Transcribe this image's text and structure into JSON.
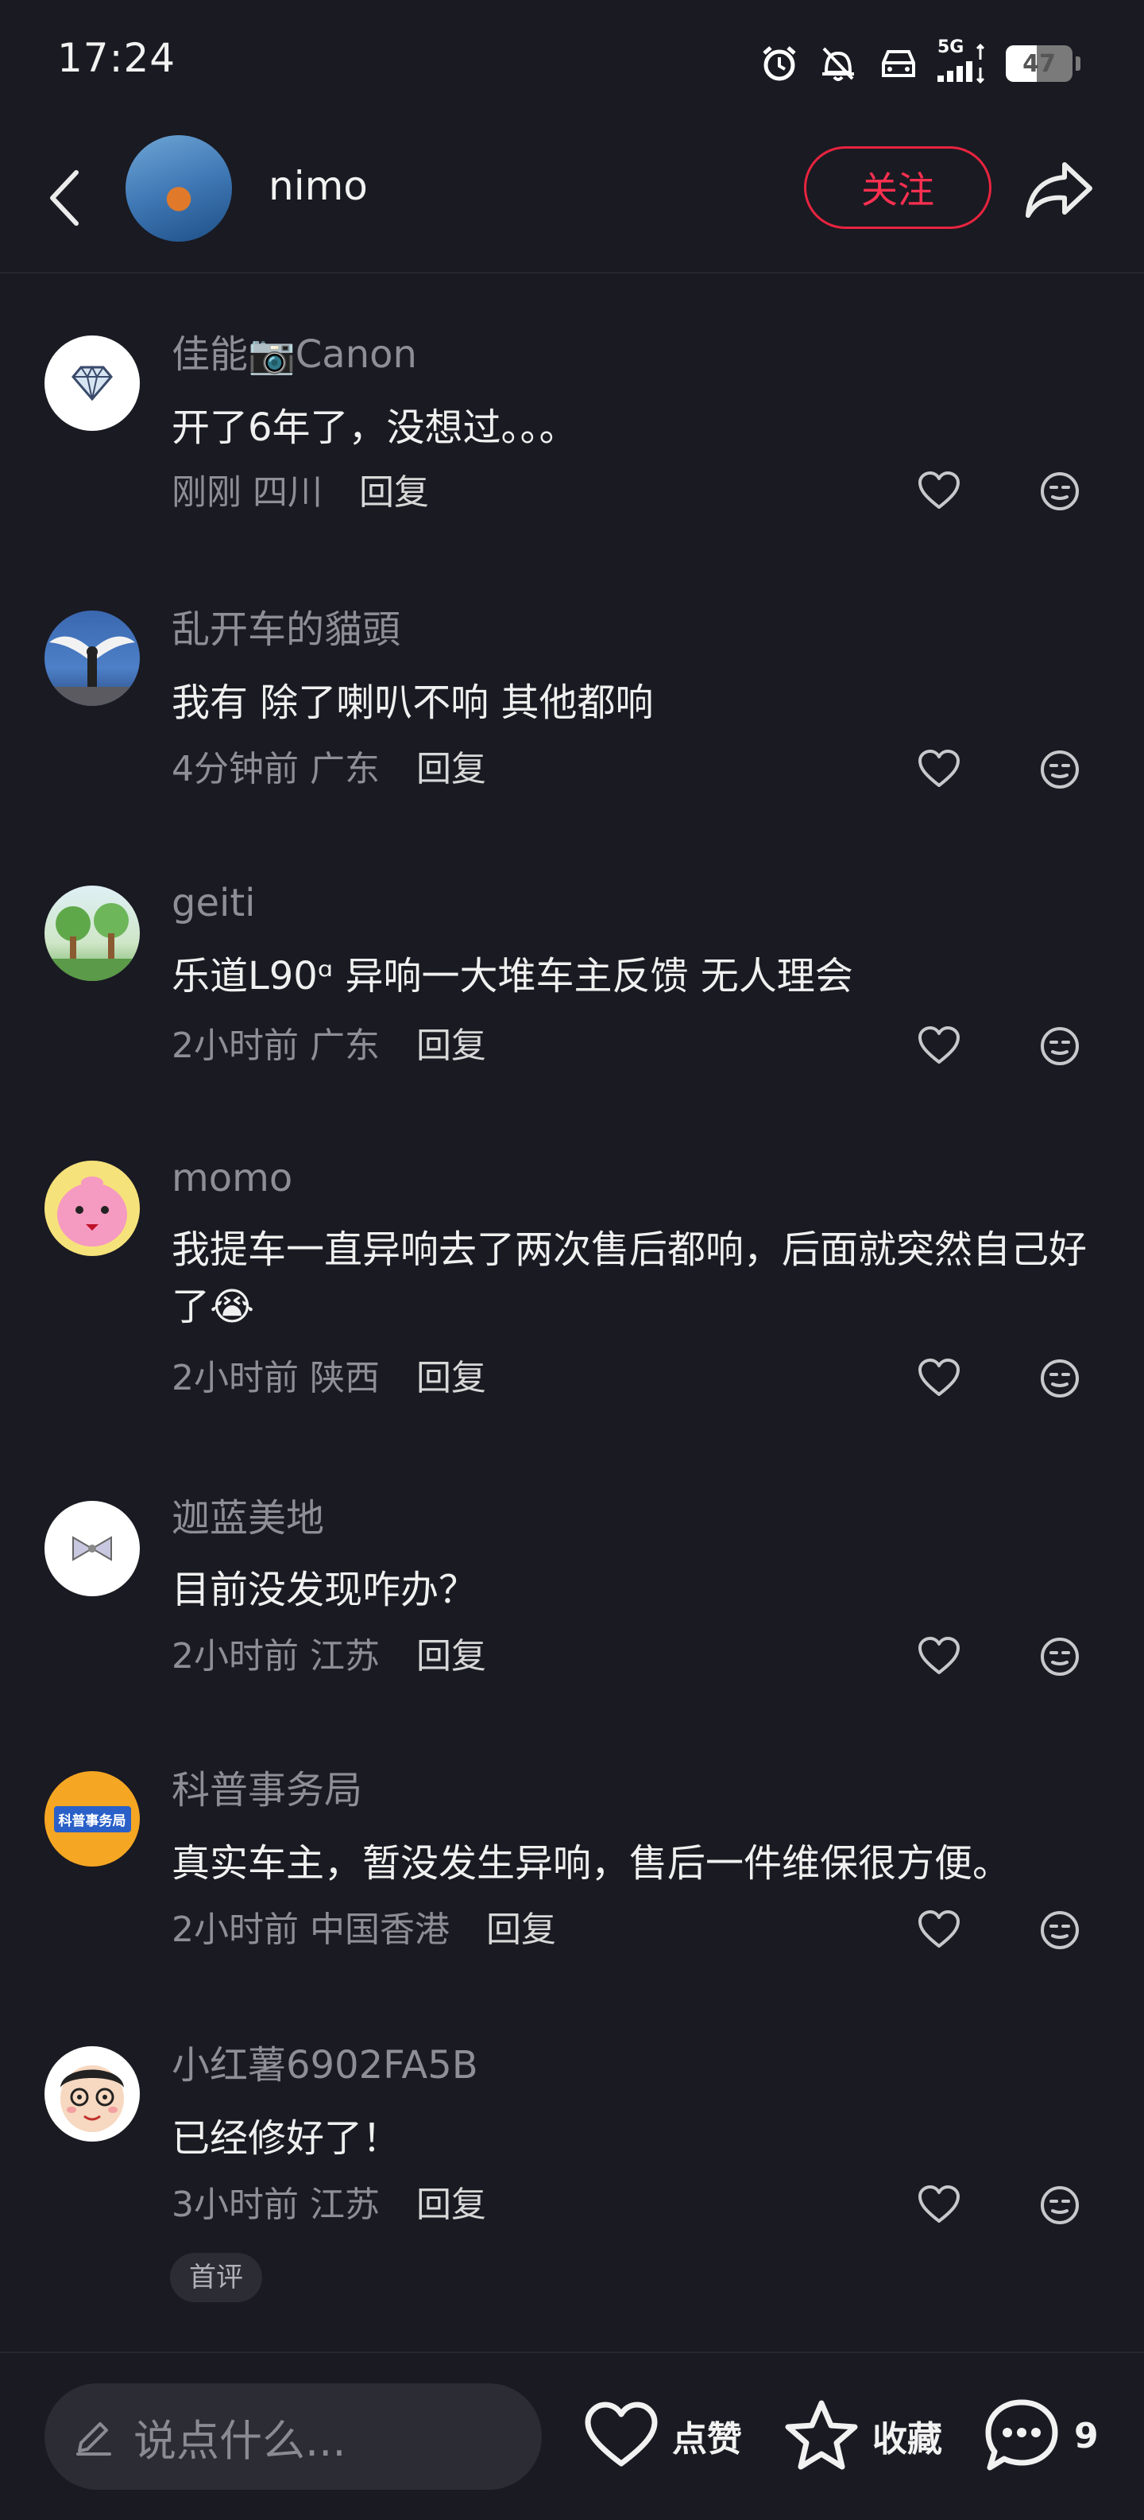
{
  "status_bar": {
    "time": "17:24",
    "network": "5G",
    "battery": "47",
    "icons": [
      "alarm-icon",
      "vibrate-off-icon",
      "car-icon",
      "signal-icon",
      "battery-icon"
    ]
  },
  "header": {
    "username": "nimo",
    "follow_label": "关注",
    "accent_color": "#ff3050"
  },
  "comments": [
    {
      "user": "佳能📷Canon",
      "text": "开了6年了，没想过。。。",
      "time": "刚刚",
      "location": "四川",
      "reply": "回复",
      "avatar": "diamond"
    },
    {
      "user": "乱开车的貓頭",
      "text": "我有 除了喇叭不响 其他都响",
      "time": "4分钟前",
      "location": "广东",
      "reply": "回复",
      "avatar": "wings"
    },
    {
      "user": "geiti",
      "text": "乐道L90ᵅ 异响一大堆车主反馈 无人理会",
      "time": "2小时前",
      "location": "广东",
      "reply": "回复",
      "avatar": "trees"
    },
    {
      "user": "momo",
      "text": "我提车一直异响去了两次售后都响，后面就突然自己好了😭",
      "time": "2小时前",
      "location": "陕西",
      "reply": "回复",
      "avatar": "pink"
    },
    {
      "user": "迦蓝美地",
      "text": "目前没发现咋办？",
      "time": "2小时前",
      "location": "江苏",
      "reply": "回复",
      "avatar": "bow"
    },
    {
      "user": "科普事务局",
      "text": "真实车主，暂没发生异响，售后一件维保很方便。",
      "time": "2小时前",
      "location": "中国香港",
      "reply": "回复",
      "avatar": "orange",
      "avatar_text": "科普事务局"
    },
    {
      "user": "小红薯6902FA5B",
      "text": "已经修好了！",
      "time": "3小时前",
      "location": "江苏",
      "reply": "回复",
      "avatar": "cartoon",
      "badge": "首评"
    }
  ],
  "bottom_bar": {
    "input_placeholder": "说点什么...",
    "like_label": "点赞",
    "collect_label": "收藏",
    "comment_count": "9"
  }
}
